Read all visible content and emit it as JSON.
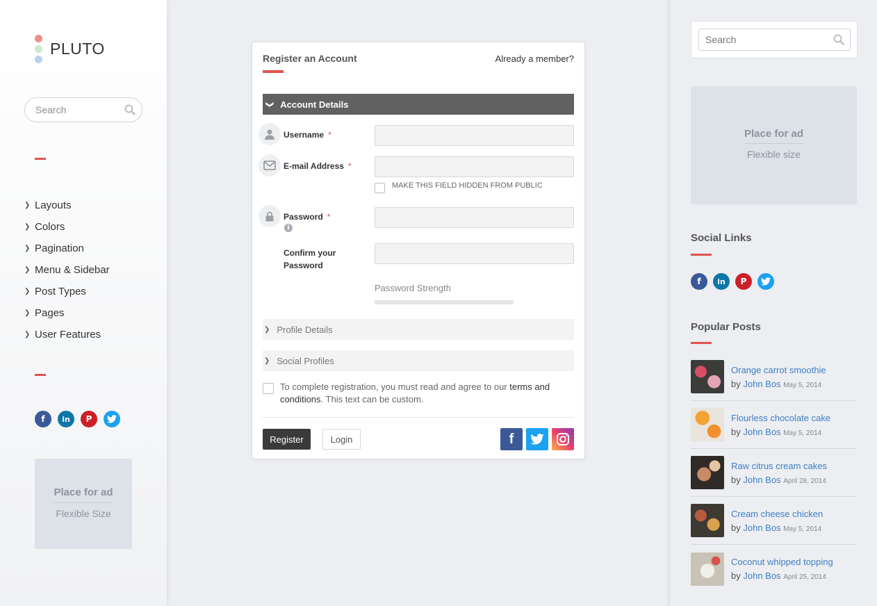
{
  "brand": {
    "name": "PLUTO",
    "dot_colors": [
      "#ef8f8c",
      "#cde9d0",
      "#b9d2ee"
    ]
  },
  "left_sidebar": {
    "search_placeholder": "Search",
    "nav": [
      "Layouts",
      "Colors",
      "Pagination",
      "Menu & Sidebar",
      "Post Types",
      "Pages",
      "User Features"
    ],
    "ad": {
      "title": "Place for ad",
      "subtitle": "Flexible Size"
    }
  },
  "form": {
    "title": "Register an Account",
    "already_member": "Already a member?",
    "section_account": "Account Details",
    "fields": {
      "username": {
        "label": "Username",
        "required": "*"
      },
      "email": {
        "label": "E-mail Address",
        "required": "*"
      },
      "hide_email": "MAKE THIS FIELD HIDDEN FROM PUBLIC",
      "password": {
        "label": "Password",
        "required": "*"
      },
      "confirm_line1": "Confirm your",
      "confirm_line2": "Password"
    },
    "password_strength": "Password Strength",
    "section_profile": "Profile Details",
    "section_social": "Social Profiles",
    "terms_text1": "To complete registration, you must read and agree to our ",
    "terms_link": "terms and conditions",
    "terms_text2": ". This text can be custom.",
    "register_label": "Register",
    "login_label": "Login"
  },
  "right_sidebar": {
    "search_placeholder": "Search",
    "ad": {
      "title": "Place for ad",
      "subtitle": "Flexible size"
    },
    "social_links_heading": "Social Links",
    "popular_posts_heading": "Popular Posts",
    "posts": [
      {
        "title": "Orange carrot smoothie",
        "by": "by",
        "author": "John Bos",
        "date": "May 5, 2014"
      },
      {
        "title": "Flourless chocolate cake",
        "by": "by",
        "author": "John Bos",
        "date": "May 5, 2014"
      },
      {
        "title": "Raw citrus cream cakes",
        "by": "by",
        "author": "John Bos",
        "date": "April 28, 2014"
      },
      {
        "title": "Cream cheese chicken",
        "by": "by",
        "author": "John Bos",
        "date": "May 5, 2014"
      },
      {
        "title": "Coconut whipped topping",
        "by": "by",
        "author": "John Bos",
        "date": "April 25, 2014"
      }
    ]
  },
  "colors": {
    "accent_red": "#e3514e",
    "link_blue": "#3e7fc6",
    "facebook": "#3b5998",
    "linkedin": "#0e76a8",
    "pinterest": "#cb2027",
    "twitter": "#1da1f2"
  }
}
